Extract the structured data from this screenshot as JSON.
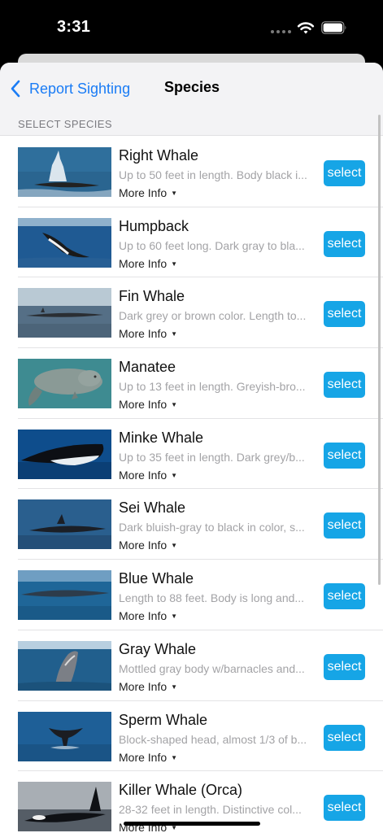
{
  "status_bar": {
    "time": "3:31"
  },
  "nav": {
    "back_label": "Report Sighting",
    "title": "Species"
  },
  "section": {
    "header": "SELECT SPECIES"
  },
  "species": [
    {
      "name": "Right Whale",
      "description": "Up to 50 feet in length. Body black i...",
      "more_info": "More Info",
      "select_label": "select"
    },
    {
      "name": "Humpback",
      "description": "Up to 60 feet long. Dark gray to bla...",
      "more_info": "More Info",
      "select_label": "select"
    },
    {
      "name": "Fin Whale",
      "description": "Dark grey or brown color. Length to...",
      "more_info": "More Info",
      "select_label": "select"
    },
    {
      "name": "Manatee",
      "description": "Up to  13 feet in length. Greyish-bro...",
      "more_info": "More Info",
      "select_label": "select"
    },
    {
      "name": "Minke Whale",
      "description": "Up to  35 feet in length. Dark grey/b...",
      "more_info": "More Info",
      "select_label": "select"
    },
    {
      "name": "Sei Whale",
      "description": "Dark bluish-gray to black in color, s...",
      "more_info": "More Info",
      "select_label": "select"
    },
    {
      "name": "Blue Whale",
      "description": "Length to 88 feet. Body is long and...",
      "more_info": "More Info",
      "select_label": "select"
    },
    {
      "name": "Gray Whale",
      "description": "Mottled gray body w/barnacles and...",
      "more_info": "More Info",
      "select_label": "select"
    },
    {
      "name": "Sperm Whale",
      "description": "Block-shaped head, almost 1/3 of b...",
      "more_info": "More Info",
      "select_label": "select"
    },
    {
      "name": "Killer Whale (Orca)",
      "description": "28-32 feet in length. Distinctive col...",
      "more_info": "More Info",
      "select_label": "select"
    }
  ],
  "colors": {
    "accent": "#1a7cf5",
    "select_button": "#16a5e6",
    "nav_background": "#f3f3f5"
  }
}
